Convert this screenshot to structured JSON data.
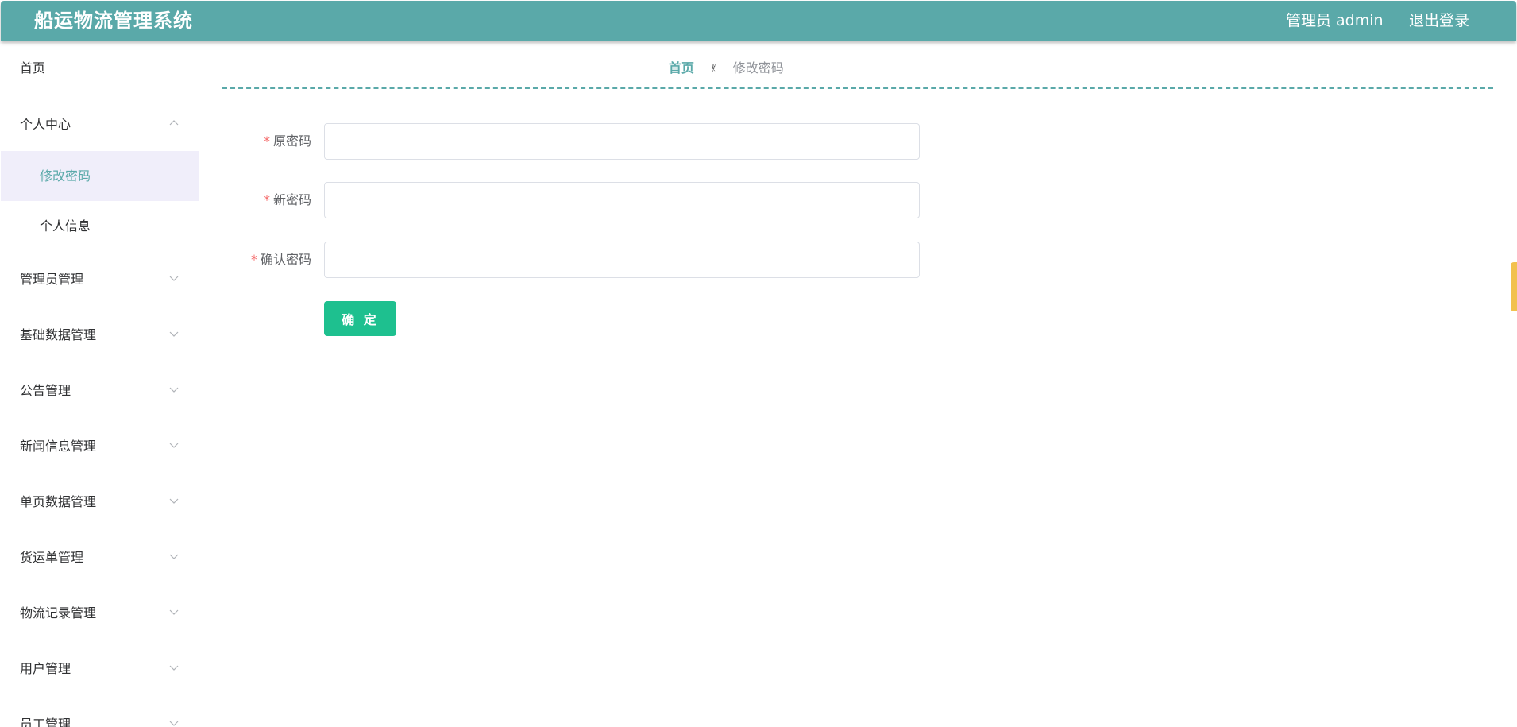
{
  "header": {
    "title": "船运物流管理系统",
    "user_info": "管理员 admin",
    "logout_label": "退出登录"
  },
  "sidebar": {
    "items": [
      {
        "label": "首页",
        "has_arrow": false
      },
      {
        "label": "个人中心",
        "has_arrow": true,
        "expanded": true,
        "children": [
          {
            "label": "修改密码",
            "active": true
          },
          {
            "label": "个人信息",
            "active": false
          }
        ]
      },
      {
        "label": "管理员管理",
        "has_arrow": true,
        "expanded": false
      },
      {
        "label": "基础数据管理",
        "has_arrow": true,
        "expanded": false
      },
      {
        "label": "公告管理",
        "has_arrow": true,
        "expanded": false
      },
      {
        "label": "新闻信息管理",
        "has_arrow": true,
        "expanded": false
      },
      {
        "label": "单页数据管理",
        "has_arrow": true,
        "expanded": false
      },
      {
        "label": "货运单管理",
        "has_arrow": true,
        "expanded": false
      },
      {
        "label": "物流记录管理",
        "has_arrow": true,
        "expanded": false
      },
      {
        "label": "用户管理",
        "has_arrow": true,
        "expanded": false
      },
      {
        "label": "员工管理",
        "has_arrow": true,
        "expanded": false
      }
    ]
  },
  "breadcrumb": {
    "home": "首页",
    "separator": "✌",
    "current": "修改密码"
  },
  "form": {
    "fields": [
      {
        "label": "原密码",
        "required": "*",
        "value": "",
        "placeholder": ""
      },
      {
        "label": "新密码",
        "required": "*",
        "value": "",
        "placeholder": ""
      },
      {
        "label": "确认密码",
        "required": "*",
        "value": "",
        "placeholder": ""
      }
    ],
    "submit_label": "确 定"
  },
  "colors": {
    "accent": "#5aa9a9",
    "submit": "#1ec08f",
    "required": "#f56c6c",
    "active_bg": "#f0eefa",
    "side_tab": "#f2c14e"
  },
  "icons": {
    "breadcrumb_separator": "victory-hand-icon",
    "menu_expand": "chevron-down-icon",
    "menu_collapse": "chevron-up-icon"
  }
}
